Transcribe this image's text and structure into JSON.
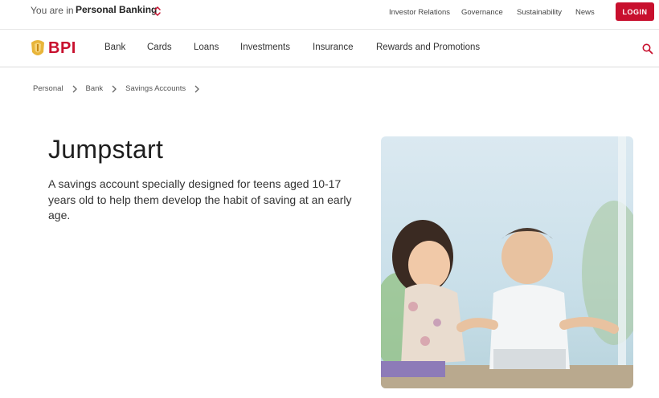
{
  "topbar": {
    "you_are_in": "You are in",
    "segment": "Personal Banking",
    "links": [
      "Investor Relations",
      "Governance",
      "Sustainability",
      "News"
    ],
    "login": "LOGIN"
  },
  "nav": {
    "brand": "BPI",
    "items": [
      "Bank",
      "Cards",
      "Loans",
      "Investments",
      "Insurance",
      "Rewards and Promotions"
    ]
  },
  "breadcrumb": [
    "Personal",
    "Bank",
    "Savings Accounts"
  ],
  "hero": {
    "title": "Jumpstart",
    "description": "A savings account specially designed for teens aged 10-17 years old to help them develop the habit of saving at an early age."
  },
  "colors": {
    "brand_red": "#c8102e",
    "brand_gold": "#e8b53a"
  },
  "icons": [
    "chevron-updown-icon",
    "search-icon",
    "chevron-right-icon"
  ]
}
